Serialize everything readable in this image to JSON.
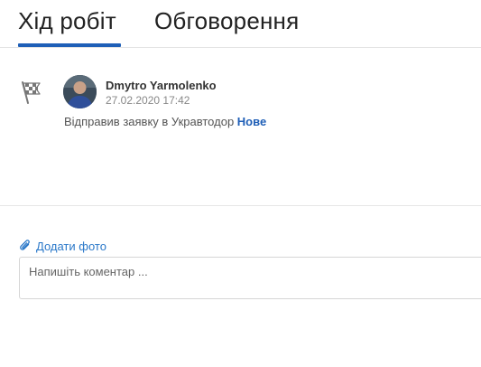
{
  "tabs": [
    {
      "label": "Хід робіт",
      "active": true
    },
    {
      "label": "Обговорення",
      "active": false
    }
  ],
  "accent_color": "#1f5fb7",
  "feed": [
    {
      "icon": "checkered-flag-icon",
      "author": "Dmytro Yarmolenko",
      "timestamp": "27.02.2020 17:42",
      "action_text": "Відправив заявку в Укравтодор",
      "status": "Нове"
    }
  ],
  "comment": {
    "add_photo_label": "Додати фото",
    "add_photo_icon": "paperclip-icon",
    "placeholder": "Напишіть коментар ...",
    "value": ""
  }
}
